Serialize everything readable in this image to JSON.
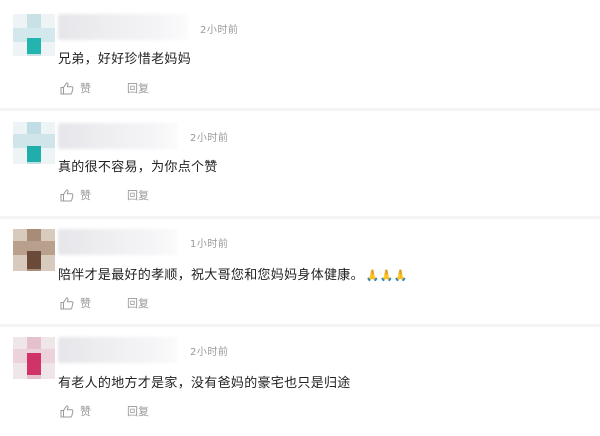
{
  "comments": [
    {
      "time": "2小时前",
      "text": "兄弟，好好珍惜老妈妈",
      "like_label": "赞",
      "reply_label": "回复",
      "avatar_colors": [
        "#e4ecf0",
        "#bfe0e2",
        "#22b5b0",
        "#cfe6ea"
      ]
    },
    {
      "time": "2小时前",
      "text": "真的很不容易，为你点个赞",
      "like_label": "赞",
      "reply_label": "回复",
      "avatar_colors": [
        "#e2ecf2",
        "#b6dde2",
        "#1faeaa",
        "#c9e3e8"
      ]
    },
    {
      "time": "1小时前",
      "text": "陪伴才是最好的孝顺，祝大哥您和您妈妈身体健康。",
      "emoji": "🙏🙏🙏",
      "like_label": "赞",
      "reply_label": "回复",
      "avatar_colors": [
        "#c9b8a6",
        "#8a6a55",
        "#6b4a3a",
        "#b39b86"
      ]
    },
    {
      "time": "2小时前",
      "text": "有老人的地方才是家，没有爸妈的豪宅也只是归途",
      "like_label": "赞",
      "reply_label": "回复",
      "avatar_colors": [
        "#e9dfe3",
        "#e7b9c8",
        "#d0326a",
        "#efd3dc"
      ]
    }
  ]
}
